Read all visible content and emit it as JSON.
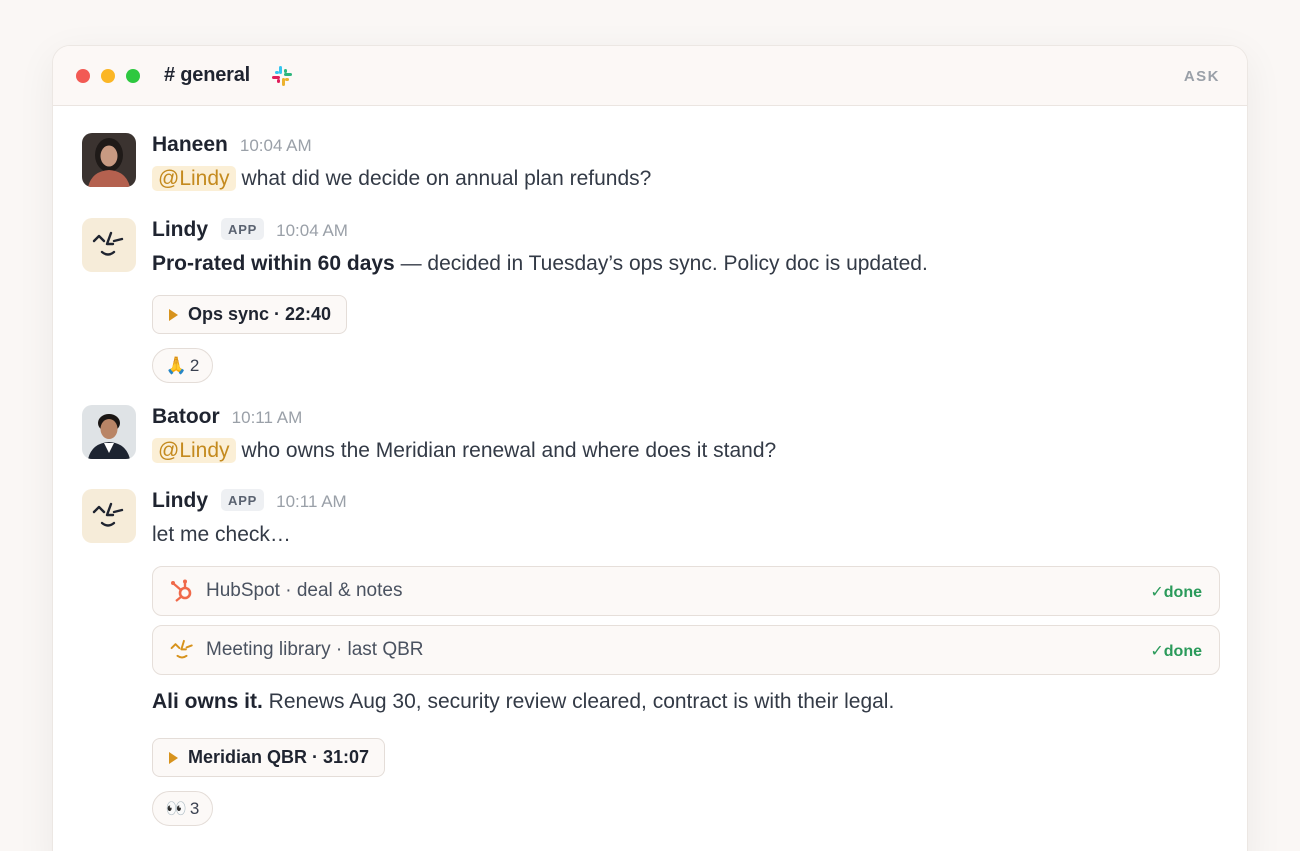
{
  "header": {
    "channel": "# general",
    "ask_label": "ASK"
  },
  "messages": [
    {
      "name": "Haneen",
      "time": "10:04 AM",
      "mention": "@Lindy",
      "text": "what did we decide on annual plan refunds?"
    },
    {
      "name": "Lindy",
      "badge": "APP",
      "time": "10:04 AM",
      "bold": "Pro-rated within 60 days",
      "text": " — decided in Tuesday’s ops sync. Policy doc is updated.",
      "clip": "Ops sync · 22:40",
      "reaction_emoji": "🙏",
      "reaction_count": "2"
    },
    {
      "name": "Batoor",
      "time": "10:11 AM",
      "mention": "@Lindy",
      "text": "who owns the Meridian renewal and where does it stand?"
    },
    {
      "name": "Lindy",
      "badge": "APP",
      "time": "10:11 AM",
      "intro": "let me check…",
      "tools": [
        {
          "label": "HubSpot · deal & notes",
          "status": "✓done",
          "icon": "hubspot-icon"
        },
        {
          "label": "Meeting library · last QBR",
          "status": "✓done",
          "icon": "lindy-icon"
        }
      ],
      "bold": "Ali owns it.",
      "text": " Renews Aug 30, security review cleared, contract is with their legal.",
      "clip": "Meridian QBR · 31:07",
      "reaction_emoji": "👀",
      "reaction_count": "3"
    }
  ],
  "colors": {
    "accent": "#d7931d",
    "success": "#2a9a5a",
    "mention_bg": "#fbefd6",
    "mention_text": "#c48a1e"
  }
}
